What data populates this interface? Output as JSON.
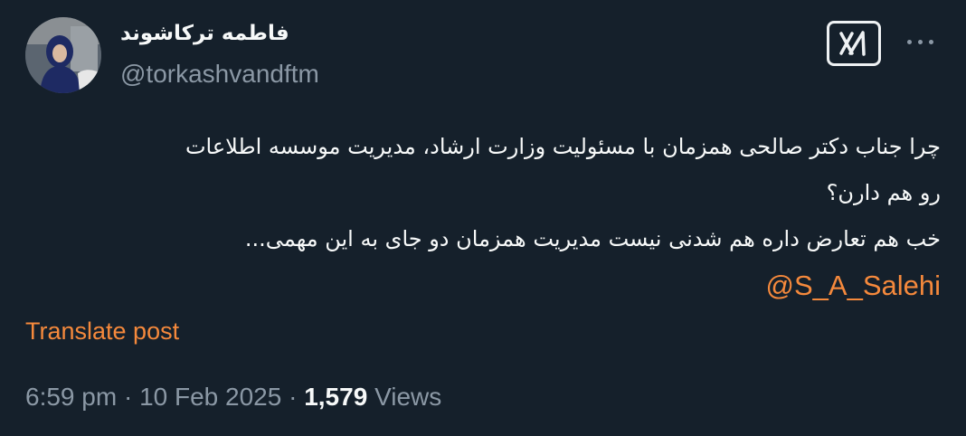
{
  "author": {
    "display_name": "فاطمه ترکاشوند",
    "handle": "@torkashvandftm",
    "avatar_icon": "profile-photo"
  },
  "header": {
    "grok_icon": "grok-icon",
    "more_icon": "more-dots-icon"
  },
  "tweet": {
    "lines": [
      "چرا جناب دکتر صالحی همزمان با مسئولیت وزارت ارشاد، مدیریت موسسه اطلاعات",
      "رو  هم دارن؟",
      "خب هم تعارض داره هم شدنی نیست مدیریت همزمان دو جای به این مهمی..."
    ],
    "mention": "@S_A_Salehi"
  },
  "translate_label": "Translate post",
  "meta": {
    "time": "6:59 pm",
    "separator": "·",
    "date": "10 Feb 2025",
    "views_count": "1,579",
    "views_label": "Views"
  },
  "colors": {
    "background": "#15202b",
    "primary_text": "#f7f9f9",
    "secondary_text": "#8b98a5",
    "accent": "#f5893c"
  }
}
